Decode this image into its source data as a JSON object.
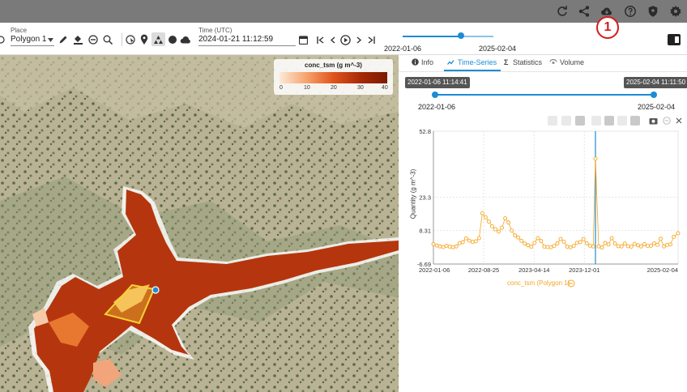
{
  "header": {
    "icons": [
      "refresh-icon",
      "share-icon",
      "cloud-download-icon",
      "help-icon",
      "shield-icon",
      "settings-icon"
    ],
    "callout_number": "1"
  },
  "toolbar": {
    "place_label": "Place",
    "place_value": "Polygon 1",
    "time_label": "Time (UTC)",
    "time_value": "2024-01-21 11:12:59"
  },
  "range_slider": {
    "start_label": "2022-01-06",
    "end_label": "2025-02-04"
  },
  "legend": {
    "title": "conc_tsm (g m^-3)",
    "ticks": [
      "0",
      "10",
      "20",
      "30",
      "40"
    ]
  },
  "panel": {
    "tabs": [
      {
        "label": "Info",
        "icon": "info-icon"
      },
      {
        "label": "Time-Series",
        "icon": "timeseries-icon"
      },
      {
        "label": "Statistics",
        "icon": "sigma-icon"
      },
      {
        "label": "Volume",
        "icon": "volume-icon"
      }
    ],
    "active_tab": "Time-Series",
    "range_start_chip": "2022-01-06 11:14:41",
    "range_end_chip": "2025-02-04 11:11:50",
    "range_start_date": "2022-01-06",
    "range_end_date": "2025-02-04",
    "series_label": "conc_tsm (Polygon 1)"
  },
  "colors": {
    "accent": "#1d8bd6",
    "series": "#f5a623",
    "topbar": "#7a7a7a"
  },
  "chart_data": {
    "type": "line",
    "ylabel": "Quantity (g m^-3)",
    "y_ticks": [
      "52.8",
      "23.3",
      "8.31",
      "-6.69"
    ],
    "x_ticks": [
      "2022-01-06",
      "2022-08-25",
      "2023-04-14",
      "2023-12-01",
      "2025-02-04"
    ],
    "ylim": [
      -6.69,
      52.8
    ],
    "x_range": [
      "2022-01-06",
      "2025-02-04"
    ],
    "grid": true,
    "selected_time": "2024-01-21",
    "series": [
      {
        "name": "conc_tsm (Polygon 1)",
        "x": [
          "2022-01-06",
          "2022-01-21",
          "2022-02-05",
          "2022-02-20",
          "2022-03-07",
          "2022-03-22",
          "2022-04-06",
          "2022-04-21",
          "2022-05-06",
          "2022-05-21",
          "2022-06-05",
          "2022-06-20",
          "2022-07-05",
          "2022-07-20",
          "2022-08-04",
          "2022-08-19",
          "2022-09-03",
          "2022-09-18",
          "2022-10-03",
          "2022-10-18",
          "2022-11-02",
          "2022-11-17",
          "2022-12-02",
          "2022-12-17",
          "2023-01-01",
          "2023-01-16",
          "2023-01-31",
          "2023-02-15",
          "2023-03-02",
          "2023-03-17",
          "2023-04-01",
          "2023-04-16",
          "2023-05-01",
          "2023-05-16",
          "2023-05-31",
          "2023-06-15",
          "2023-06-30",
          "2023-07-15",
          "2023-07-30",
          "2023-08-14",
          "2023-08-29",
          "2023-09-13",
          "2023-09-28",
          "2023-10-13",
          "2023-10-28",
          "2023-11-12",
          "2023-11-27",
          "2023-12-12",
          "2023-12-27",
          "2024-01-11",
          "2024-01-21",
          "2024-02-05",
          "2024-02-20",
          "2024-03-06",
          "2024-03-21",
          "2024-04-05",
          "2024-04-20",
          "2024-05-05",
          "2024-05-20",
          "2024-06-04",
          "2024-06-19",
          "2024-07-04",
          "2024-07-19",
          "2024-08-03",
          "2024-08-18",
          "2024-09-02",
          "2024-09-17",
          "2024-10-02",
          "2024-10-17",
          "2024-11-01",
          "2024-11-16",
          "2024-12-01",
          "2024-12-16",
          "2024-12-31",
          "2025-01-15",
          "2025-02-04"
        ],
        "values": [
          2.2,
          1.6,
          1.2,
          0.9,
          1.5,
          1.1,
          0.8,
          1.2,
          2.6,
          3.1,
          4.8,
          3.8,
          3.2,
          3.5,
          4.9,
          16.1,
          14.2,
          12.3,
          10.2,
          8.9,
          7.8,
          9.6,
          13.8,
          11.9,
          8.3,
          6.1,
          5.2,
          3.7,
          2.5,
          1.7,
          1.1,
          2.8,
          4.9,
          3.6,
          1.1,
          0.9,
          0.8,
          1.4,
          2.6,
          4.5,
          3.3,
          1.1,
          0.8,
          1.4,
          2.8,
          3.1,
          4.5,
          2.6,
          1.5,
          1.2,
          40.5,
          1.2,
          0.7,
          2.7,
          2.1,
          4.9,
          2.5,
          1.3,
          1.2,
          2.5,
          1.3,
          1.1,
          2.3,
          1.7,
          1.2,
          2.2,
          1.4,
          1.5,
          2.6,
          1.9,
          4.6,
          1.2,
          1.9,
          2.1,
          5.5,
          7.1
        ]
      }
    ]
  }
}
